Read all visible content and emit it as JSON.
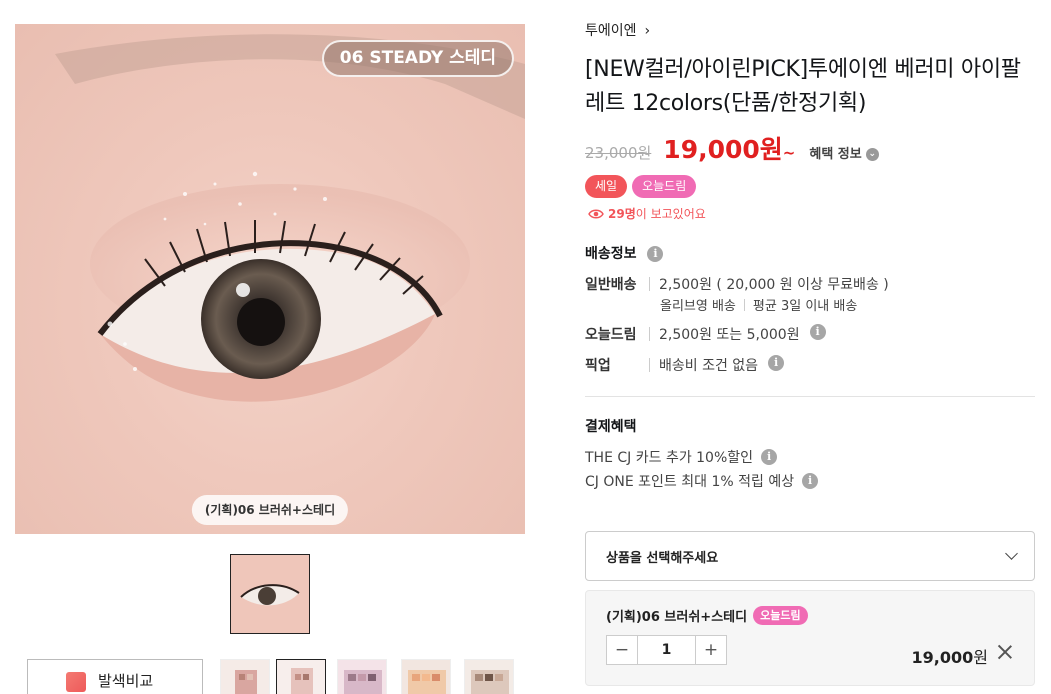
{
  "gallery": {
    "shade_tag": "06 STEADY 스테디",
    "caption": "(기획)06 브러쉬+스테디",
    "compare_label": "발색비교"
  },
  "product": {
    "brand": "투에이엔",
    "brand_chevron": "›",
    "title": "[NEW컬러/아이린PICK]투에이엔 베러미 아이팔레트 12colors(단품/한정기획)",
    "original_price": "23,000원",
    "sale_price": "19,000원",
    "sale_suffix": "~",
    "benefit_label": "혜택 정보",
    "badges": [
      "세일",
      "오늘드림"
    ],
    "viewers_count": "29명",
    "viewers_text": "이 보고있어요"
  },
  "shipping": {
    "title": "배송정보",
    "rows": [
      {
        "key": "일반배송",
        "value": "2,500원 ( 20,000 원 이상 무료배송 )"
      },
      {
        "key": "오늘드림",
        "value": "2,500원 또는 5,000원"
      },
      {
        "key": "픽업",
        "value": "배송비 조건 없음"
      }
    ],
    "sub_a": "올리브영 배송",
    "sub_b": "평균 3일 이내 배송"
  },
  "payment": {
    "title": "결제혜택",
    "lines": [
      "THE CJ 카드 추가 10%할인",
      "CJ ONE 포인트 최대 1% 적립 예상"
    ]
  },
  "order": {
    "select_placeholder": "상품을 선택해주세요",
    "option_name": "(기획)06 브러쉬+스테디",
    "option_badge": "오늘드림",
    "minus": "−",
    "plus": "+",
    "quantity": "1",
    "option_price": "19,000",
    "option_price_unit": "원"
  },
  "colors": {
    "sale_red": "#e02020",
    "badge_pink": "#f06bb4",
    "badge_red": "#f2555a"
  }
}
